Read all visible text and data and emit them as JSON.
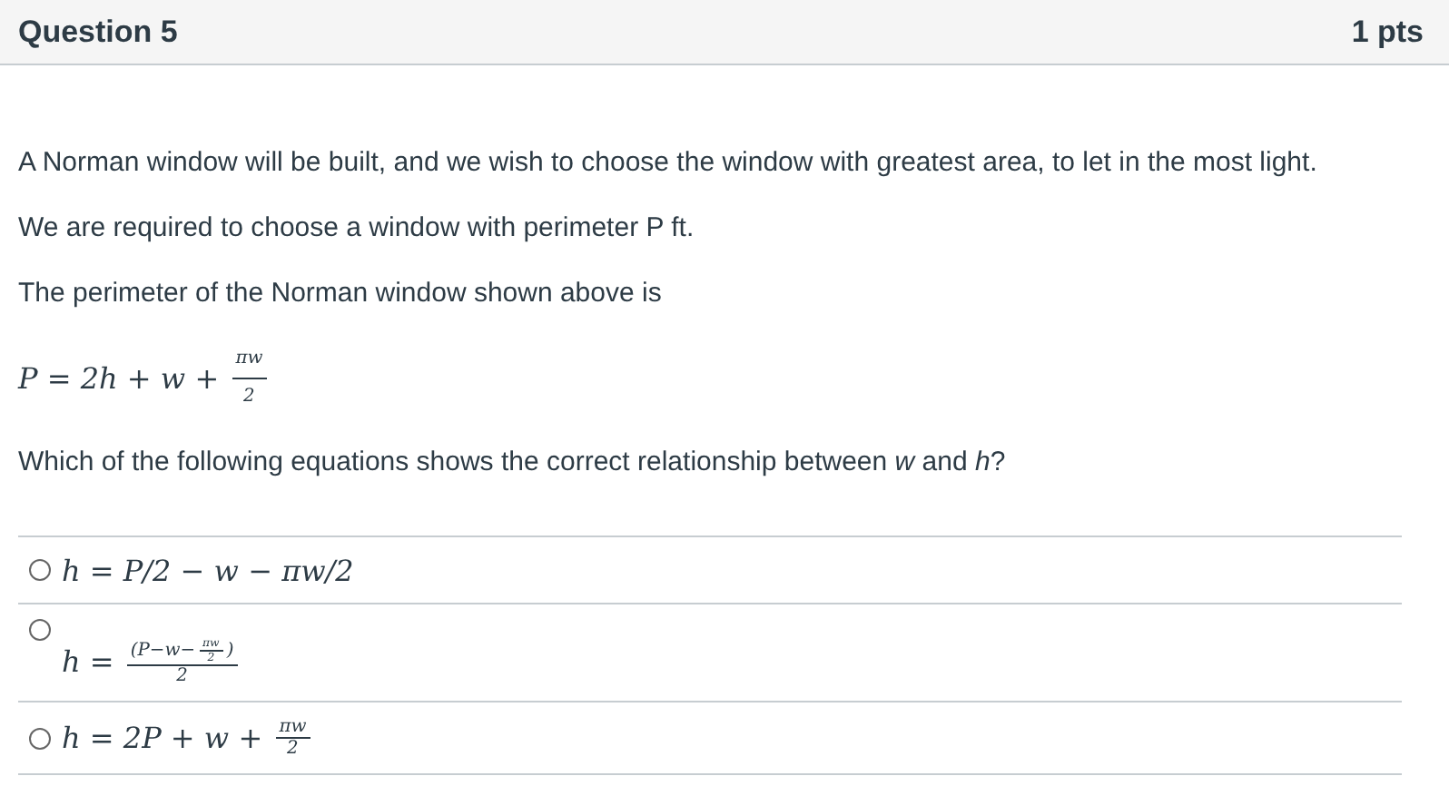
{
  "header": {
    "title": "Question 5",
    "points": "1 pts"
  },
  "paragraphs": [
    {
      "kind": "text",
      "text": "A Norman window will be built, and we wish to choose the window with greatest area, to let in the most light."
    },
    {
      "kind": "text",
      "text": "We are required to choose a window with perimeter P ft."
    },
    {
      "kind": "text",
      "text": "The perimeter of the Norman window shown above is"
    },
    {
      "kind": "math",
      "parts": [
        {
          "kind": "text",
          "text": "P = 2h + w + "
        },
        {
          "kind": "frac",
          "num": [
            {
              "kind": "text",
              "text": "πw"
            }
          ],
          "den": [
            {
              "kind": "text",
              "text": "2"
            }
          ]
        }
      ]
    },
    {
      "kind": "text",
      "text": "Which of the following equations shows the correct relationship between *w* and *h*?"
    }
  ],
  "answers": [
    {
      "selected": false,
      "parts": [
        {
          "kind": "text",
          "text": "h = P/2 − w − πw/2"
        }
      ]
    },
    {
      "selected": false,
      "parts": [
        {
          "kind": "text",
          "text": "h = "
        },
        {
          "kind": "frac",
          "num": [
            {
              "kind": "text",
              "text": "(P−w−"
            },
            {
              "kind": "frac",
              "num": [
                {
                  "kind": "text",
                  "text": "πw"
                }
              ],
              "den": [
                {
                  "kind": "text",
                  "text": "2"
                }
              ]
            },
            {
              "kind": "text",
              "text": ")"
            }
          ],
          "den": [
            {
              "kind": "text",
              "text": "2"
            }
          ]
        }
      ]
    },
    {
      "selected": false,
      "parts": [
        {
          "kind": "text",
          "text": "h = 2P + w + "
        },
        {
          "kind": "frac",
          "num": [
            {
              "kind": "text",
              "text": "πw"
            }
          ],
          "den": [
            {
              "kind": "text",
              "text": "2"
            }
          ]
        }
      ]
    }
  ]
}
